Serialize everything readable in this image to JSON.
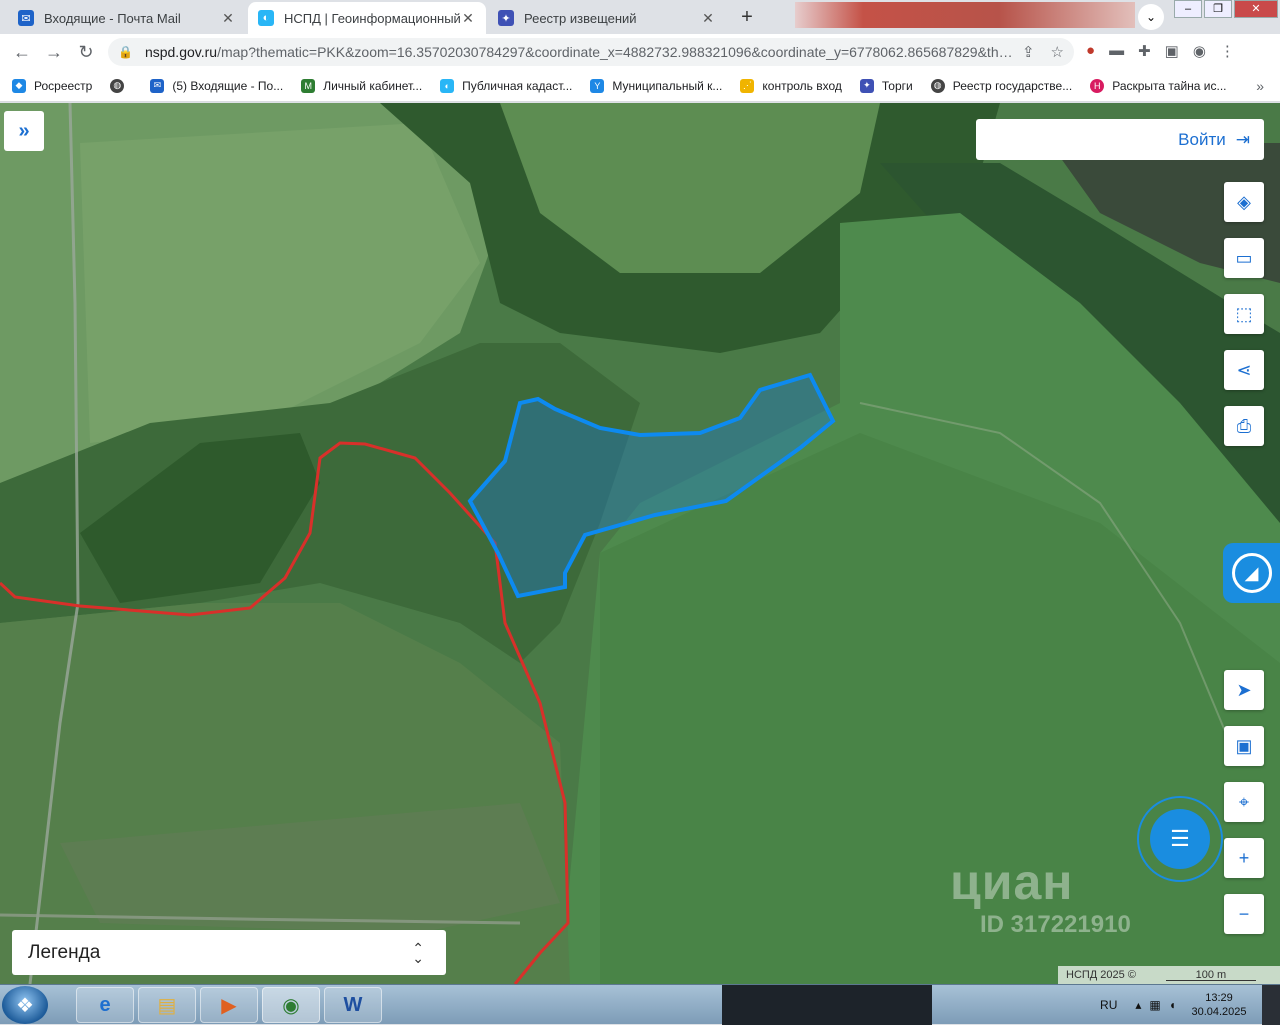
{
  "browser": {
    "tabs": [
      {
        "label": "Входящие - Почта Mail",
        "active": false
      },
      {
        "label": "НСПД | Геоинформационный п…",
        "active": true
      },
      {
        "label": "Реестр извещений",
        "active": false
      }
    ],
    "url_host": "nspd.gov.ru",
    "url_rest": "/map?thematic=PKK&zoom=16.35702030784297&coordinate_x=4882732.988321096&coordinate_y=6778062.865687829&th…"
  },
  "bookmarks": [
    {
      "label": "Росреестр",
      "color": "#1e88e5"
    },
    {
      "label": "",
      "color": "#444444"
    },
    {
      "label": "(5) Входящие - По...",
      "color": "#1e63c8"
    },
    {
      "label": "Личный кабинет...",
      "color": "#2e7d32"
    },
    {
      "label": "Публичная кадаст...",
      "color": "#29b6f6"
    },
    {
      "label": "Муниципальный к...",
      "color": "#1e88e5"
    },
    {
      "label": "контроль вход",
      "color": "#f0b400"
    },
    {
      "label": "Торги",
      "color": "#3f51b5"
    },
    {
      "label": "Реестр государстве...",
      "color": "#444444"
    },
    {
      "label": "Раскрыта тайна ис...",
      "color": "#d81b60"
    }
  ],
  "map": {
    "login_label": "Войти",
    "legend_label": "Легенда",
    "watermark_brand": "циан",
    "watermark_id": "ID 317221910",
    "attribution": "НСПД 2025 ©",
    "scale_label": "100 m"
  },
  "taskbar": {
    "lang": "RU",
    "time": "13:29",
    "date": "30.04.2025"
  },
  "colors": {
    "accent": "#1c6fd1",
    "parcel": "#0d8af0",
    "boundary": "#d8302a"
  }
}
